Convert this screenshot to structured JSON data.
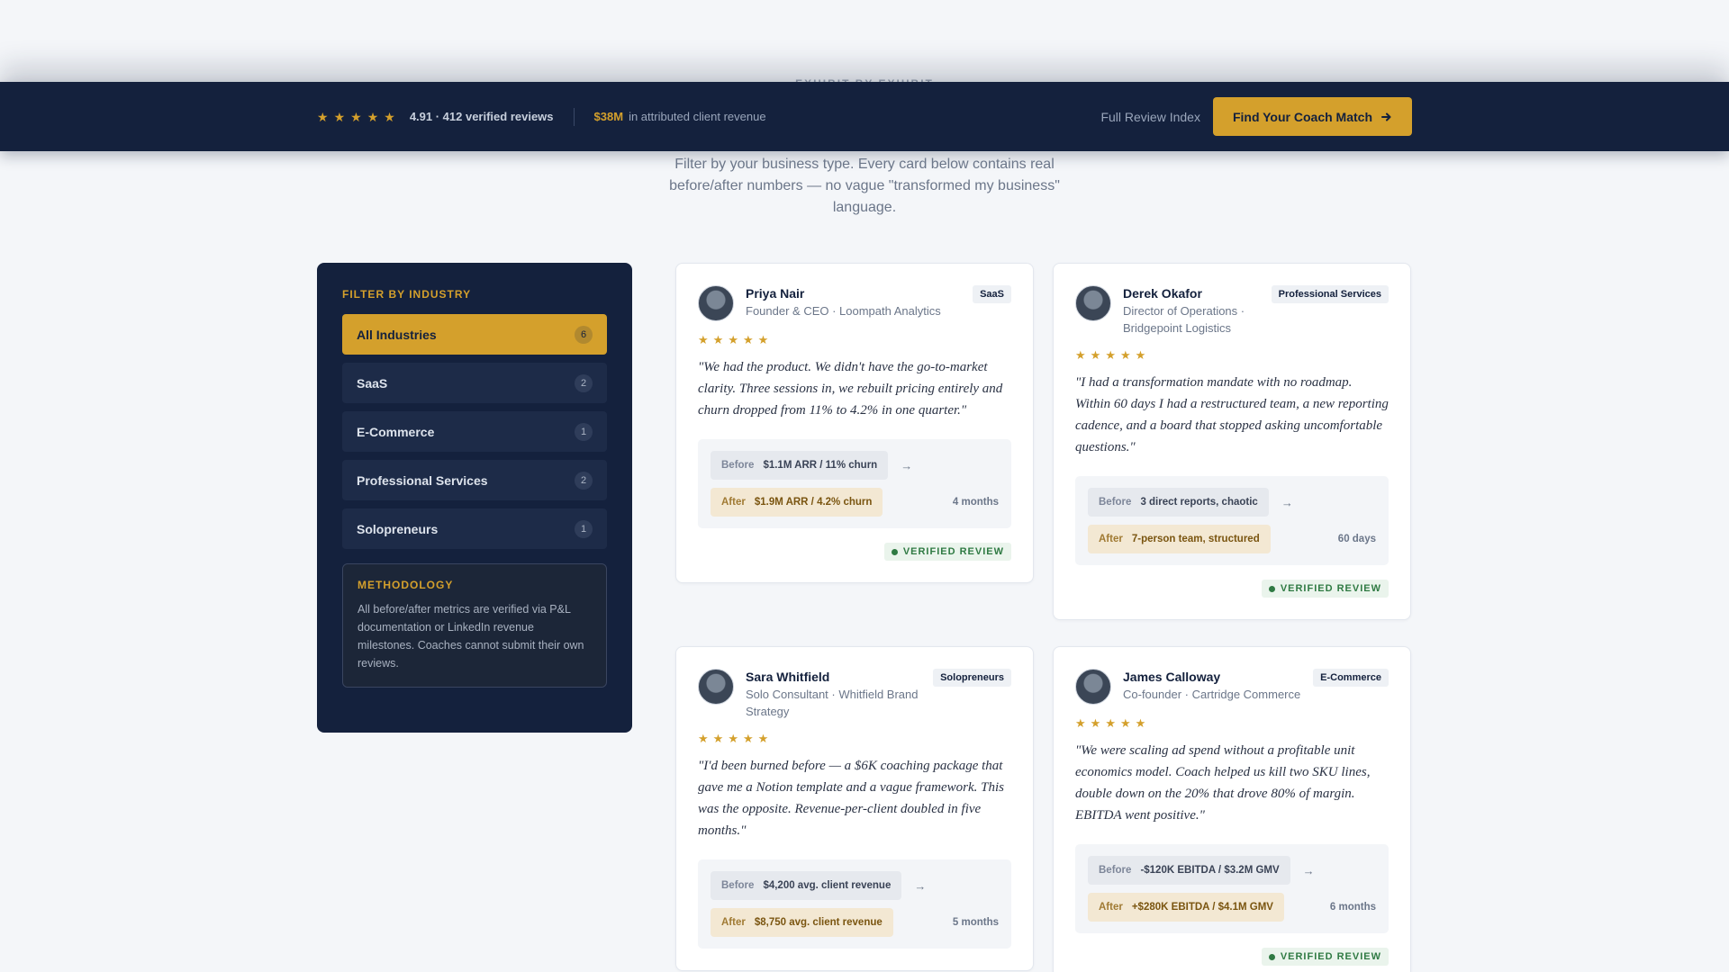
{
  "header": {
    "eyebrow": "EXHIBIT BY EXHIBIT",
    "rating_text": "4.91 · 412 verified reviews",
    "revenue_amount": "$38M",
    "revenue_text": "in attributed client revenue",
    "index_link": "Full Review Index",
    "cta_label": "Find Your Coach Match",
    "cta_icon": "arrow-right-icon",
    "accent": "#d4a02c",
    "navy": "#14213d"
  },
  "intro": "Filter by your business type. Every card below contains real before/after numbers — no vague \"transformed my business\" language.",
  "sidebar": {
    "title": "FILTER BY INDUSTRY",
    "filters": [
      {
        "label": "All Industries",
        "count": "6"
      },
      {
        "label": "SaaS",
        "count": "2"
      },
      {
        "label": "E-Commerce",
        "count": "1"
      },
      {
        "label": "Professional Services",
        "count": "2"
      },
      {
        "label": "Solopreneurs",
        "count": "1"
      }
    ],
    "methodology_title": "METHODOLOGY",
    "methodology_text": "All before/after metrics are verified via P&L documentation or LinkedIn revenue milestones. Coaches cannot submit their own reviews."
  },
  "labels": {
    "before": "Before",
    "after": "After",
    "verified": "VERIFIED REVIEW",
    "arrow": "→"
  },
  "reviews": [
    {
      "name": "Priya Nair",
      "role": "Founder & CEO · Loompath Analytics",
      "tag": "SaaS",
      "rating": 5,
      "quote": "\"We had the product. We didn't have the go-to-market clarity. Three sessions in, we rebuilt pricing entirely and churn dropped from 11% to 4.2% in one quarter.\"",
      "before": "$1.1M ARR / 11% churn",
      "after": "$1.9M ARR / 4.2% churn",
      "duration": "4 months"
    },
    {
      "name": "Derek Okafor",
      "role": "Director of Operations · Bridgepoint Logistics",
      "tag": "Professional Services",
      "rating": 5,
      "quote": "\"I had a transformation mandate with no roadmap. Within 60 days I had a restructured team, a new reporting cadence, and a board that stopped asking uncomfortable questions.\"",
      "before": "3 direct reports, chaotic",
      "after": "7-person team, structured",
      "duration": "60 days"
    },
    {
      "name": "Sara Whitfield",
      "role": "Solo Consultant · Whitfield Brand Strategy",
      "tag": "Solopreneurs",
      "rating": 5,
      "quote": "\"I'd been burned before — a $6K coaching package that gave me a Notion template and a vague framework. This was the opposite. Revenue-per-client doubled in five months.\"",
      "before": "$4,200 avg. client revenue",
      "after": "$8,750 avg. client revenue",
      "duration": "5 months"
    },
    {
      "name": "James Calloway",
      "role": "Co-founder · Cartridge Commerce",
      "tag": "E-Commerce",
      "rating": 5,
      "quote": "\"We were scaling ad spend without a profitable unit economics model. Coach helped us kill two SKU lines, double down on the 20% that drove 80% of margin. EBITDA went positive.\"",
      "before": "-$120K EBITDA / $3.2M GMV",
      "after": "+$280K EBITDA / $4.1M GMV",
      "duration": "6 months"
    }
  ]
}
